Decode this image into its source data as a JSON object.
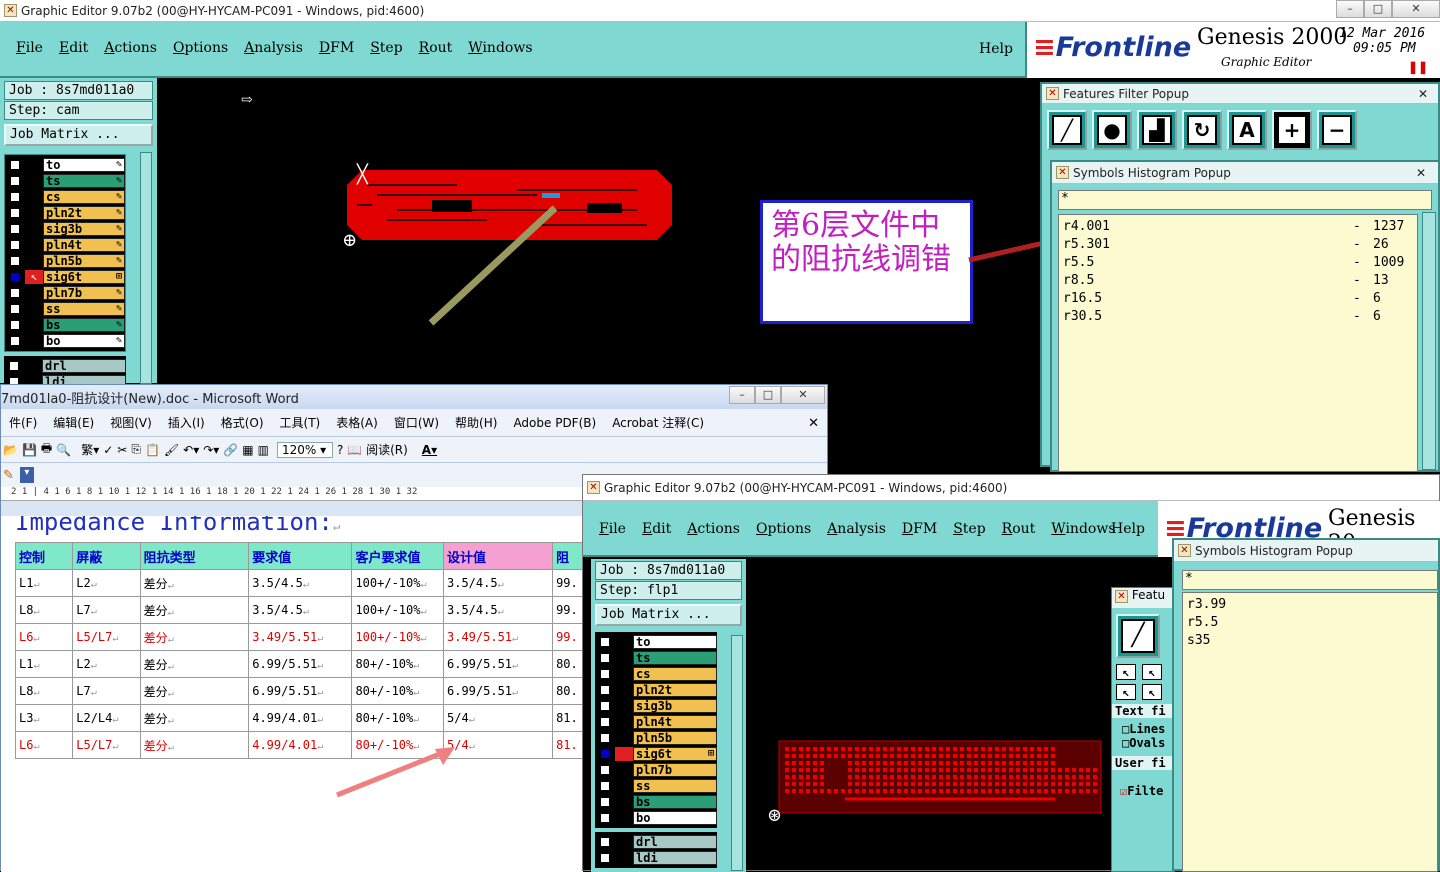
{
  "main_window": {
    "title": "Graphic Editor 9.07b2 (00@HY-HYCAM-PC091 - Windows, pid:4600)",
    "menu": [
      "File",
      "Edit",
      "Actions",
      "Options",
      "Analysis",
      "DFM",
      "Step",
      "Rout",
      "Windows"
    ],
    "help": "Help",
    "brand": "Frontline",
    "product": "Genesis 2000",
    "subtitle": "Graphic Editor",
    "date": "12 Mar 2016",
    "time": "09:05 PM",
    "job_line": "Job : 8s7md011a0",
    "step_line": "Step: cam",
    "job_matrix": "Job Matrix ...",
    "layers": [
      {
        "name": "to",
        "color": "#ffffff"
      },
      {
        "name": "ts",
        "color": "#2a9e74"
      },
      {
        "name": "cs",
        "color": "#f0c050"
      },
      {
        "name": "pln2t",
        "color": "#f0c050"
      },
      {
        "name": "sig3b",
        "color": "#f0c050"
      },
      {
        "name": "pln4t",
        "color": "#f0c050"
      },
      {
        "name": "pln5b",
        "color": "#f0c050"
      },
      {
        "name": "sig6t",
        "color": "#f0c050"
      },
      {
        "name": "pln7b",
        "color": "#f0c050"
      },
      {
        "name": "ss",
        "color": "#f0c050"
      },
      {
        "name": "bs",
        "color": "#2a9e74"
      },
      {
        "name": "bo",
        "color": "#ffffff"
      }
    ],
    "drill_layers": [
      "drl",
      "ldi"
    ]
  },
  "annotation": {
    "text": "第6层文件中的阻抗线调错",
    "color": "#c020c0"
  },
  "features_filter": {
    "title": "Features Filter Popup",
    "buttons": [
      "line-icon",
      "pad-icon",
      "surface-icon",
      "arc-icon",
      "text-icon",
      "plus-icon",
      "minus-icon"
    ]
  },
  "histogram_1": {
    "title": "Symbols Histogram Popup",
    "filter": "*",
    "rows": [
      {
        "sym": "r4.001",
        "count": "1237"
      },
      {
        "sym": "r5.301",
        "count": "26"
      },
      {
        "sym": "r5.5",
        "count": "1009"
      },
      {
        "sym": "r8.5",
        "count": "13"
      },
      {
        "sym": "r16.5",
        "count": "6"
      },
      {
        "sym": "r30.5",
        "count": "6"
      }
    ]
  },
  "word": {
    "title": "7md01la0-阻抗设计(New).doc - Microsoft Word",
    "menu": [
      "件(F)",
      "编辑(E)",
      "视图(V)",
      "插入(I)",
      "格式(O)",
      "工具(T)",
      "表格(A)",
      "窗口(W)",
      "帮助(H)",
      "Adobe PDF(B)",
      "Acrobat 注释(C)"
    ],
    "zoom": "120%",
    "read_btn": "阅读(R)",
    "ruler": "2 1 | 4 1 6 1 8 1 10 1 12 1 14 1 16 1 18 1 20 1 22 1 24 1 26 1 28 1 30 1 32",
    "heading": "Impedance Information:",
    "headers": [
      "控制",
      "屏蔽",
      "阻抗类型",
      "要求值",
      "客户要求值",
      "设计值",
      "阻"
    ],
    "rows": [
      [
        "L1",
        "L2",
        "差分",
        "3.5/4.5",
        "100+/-10%",
        "3.5/4.5",
        "99."
      ],
      [
        "L8",
        "L7",
        "差分",
        "3.5/4.5",
        "100+/-10%",
        "3.5/4.5",
        "99."
      ],
      [
        "L6",
        "L5/L7",
        "差分",
        "3.49/5.51",
        "100+/-10%",
        "3.49/5.51",
        "99."
      ],
      [
        "L1",
        "L2",
        "差分",
        "6.99/5.51",
        "80+/-10%",
        "6.99/5.51",
        "80."
      ],
      [
        "L8",
        "L7",
        "差分",
        "6.99/5.51",
        "80+/-10%",
        "6.99/5.51",
        "80."
      ],
      [
        "L3",
        "L2/L4",
        "差分",
        "4.99/4.01",
        "80+/-10%",
        "5/4",
        "81."
      ],
      [
        "L6",
        "L5/L7",
        "差分",
        "4.99/4.01",
        "80+/-10%",
        "5/4",
        "81."
      ]
    ],
    "red_rows": [
      2,
      6
    ]
  },
  "second_window": {
    "title": "Graphic Editor 9.07b2 (00@HY-HYCAM-PC091 - Windows, pid:4600)",
    "menu": [
      "File",
      "Edit",
      "Actions",
      "Options",
      "Analysis",
      "DFM",
      "Step",
      "Rout",
      "Windows"
    ],
    "help": "Help",
    "brand": "Frontline",
    "product": "Genesis 20",
    "job_line": "Job : 8s7md011a0",
    "step_line": "Step: flp1",
    "job_matrix": "Job Matrix ...",
    "filter_partial": [
      "Featu",
      "Text fi",
      "Lines",
      "Ovals",
      "User fi",
      "Filte"
    ]
  },
  "histogram_2": {
    "title": "Symbols Histogram Popup",
    "filter": "*",
    "rows": [
      "r3.99",
      "r5.5",
      "s35"
    ]
  }
}
